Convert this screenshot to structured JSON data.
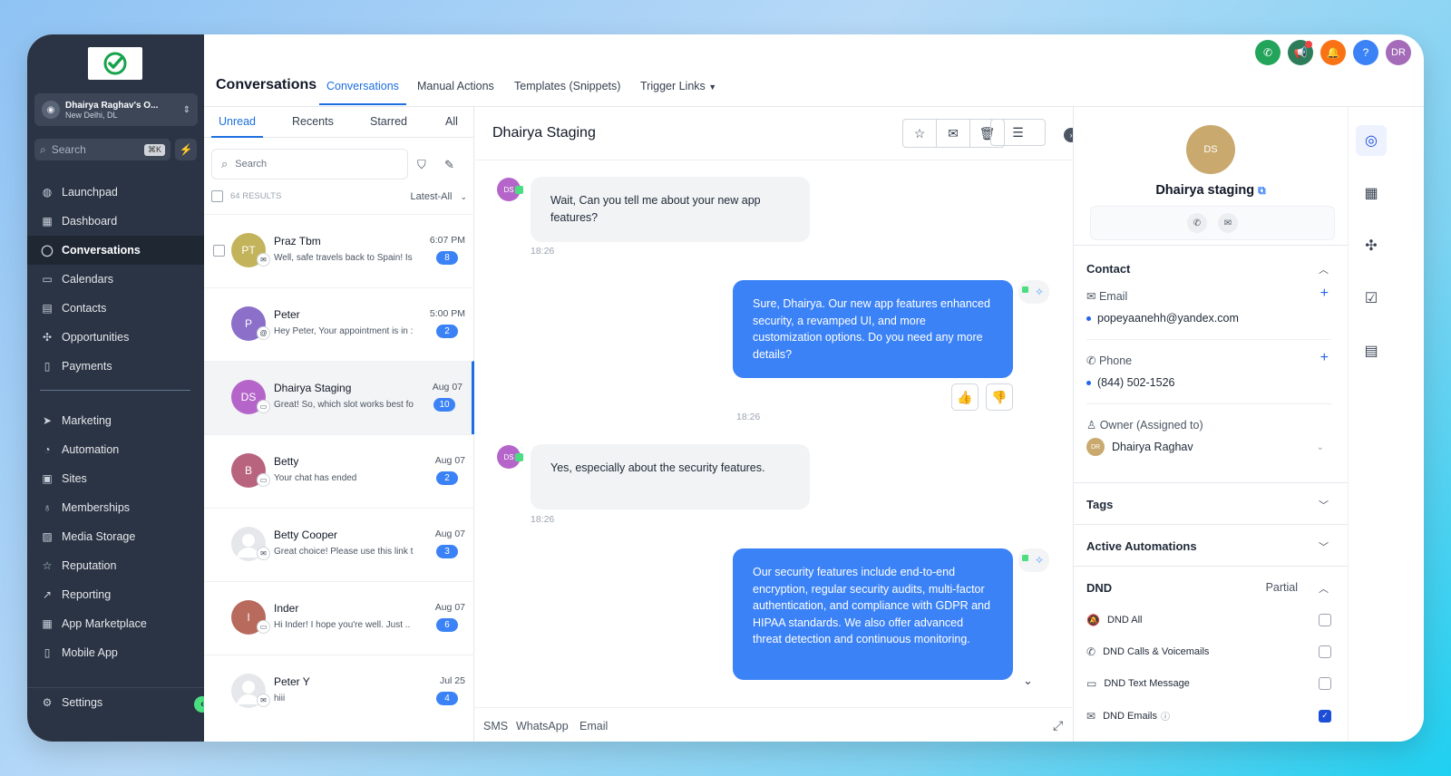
{
  "account": {
    "name": "Dhairya Raghav's O...",
    "location": "New Delhi, DL"
  },
  "sidebar": {
    "search_placeholder": "Search",
    "shortcut": "⌘K",
    "items": [
      "Launchpad",
      "Dashboard",
      "Conversations",
      "Calendars",
      "Contacts",
      "Opportunities",
      "Payments"
    ],
    "items2": [
      "Marketing",
      "Automation",
      "Sites",
      "Memberships",
      "Media Storage",
      "Reputation",
      "Reporting",
      "App Marketplace",
      "Mobile App"
    ],
    "settings": "Settings"
  },
  "header": {
    "title": "Conversations",
    "tabs": [
      "Conversations",
      "Manual Actions",
      "Templates (Snippets)",
      "Trigger Links"
    ],
    "avatar": "DR"
  },
  "list": {
    "tabs": [
      "Unread",
      "Recents",
      "Starred",
      "All"
    ],
    "search_placeholder": "Search",
    "results": "64 RESULTS",
    "sort": "Latest-All",
    "conversations": [
      {
        "initials": "PT",
        "name": "Praz Tbm",
        "preview": "Well, safe travels back to Spain! Is",
        "time": "6:07 PM",
        "count": "8",
        "color": "#c3b35b"
      },
      {
        "initials": "P",
        "name": "Peter",
        "preview": "Hey Peter, Your appointment is in :",
        "time": "5:00 PM",
        "count": "2",
        "color": "#8b6fc9"
      },
      {
        "initials": "DS",
        "name": "Dhairya Staging",
        "preview": "Great! So, which slot works best fo",
        "time": "Aug 07",
        "count": "10",
        "color": "#b565c9"
      },
      {
        "initials": "B",
        "name": "Betty",
        "preview": "Your chat has ended",
        "time": "Aug 07",
        "count": "2",
        "color": "#b9647e"
      },
      {
        "initials": "",
        "name": "Betty Cooper",
        "preview": "Great choice! Please use this link t",
        "time": "Aug 07",
        "count": "3",
        "color": "#e5e7eb"
      },
      {
        "initials": "I",
        "name": "Inder",
        "preview": "Hi Inder! I hope you're well. Just ..",
        "time": "Aug 07",
        "count": "6",
        "color": "#b86a5c"
      },
      {
        "initials": "",
        "name": "Peter Y",
        "preview": "hiii",
        "time": "Jul 25",
        "count": "4",
        "color": "#e5e7eb"
      }
    ]
  },
  "chat": {
    "name": "Dhairya Staging",
    "avatar": "DS",
    "messages": [
      {
        "text": "Wait, Can you tell me about your new app features?",
        "time": "18:26"
      },
      {
        "text": "Sure, Dhairya. Our new app features enhanced security, a revamped UI, and more customization options. Do you need any more details?",
        "time": "18:26"
      },
      {
        "text": "Yes, especially about the security features.",
        "time": "18:26"
      },
      {
        "text": "Our security features include end-to-end encryption, regular security audits, multi-factor authentication, and compliance with GDPR and HIPAA standards. We also offer advanced threat detection and continuous monitoring."
      }
    ],
    "channels": [
      "SMS",
      "WhatsApp",
      "Email"
    ]
  },
  "contact": {
    "avatar": "DS",
    "name": "Dhairya staging",
    "section": "Contact",
    "email_label": "Email",
    "email": "popeyaanehh@yandex.com",
    "phone_label": "Phone",
    "phone": "(844) 502-1526",
    "owner_label": "Owner (Assigned to)",
    "owner": "Dhairya Raghav",
    "owner_avatar": "DR",
    "tags": "Tags",
    "automations": "Active Automations",
    "dnd": "DND",
    "dnd_status": "Partial",
    "dnd_items": [
      "DND All",
      "DND Calls & Voicemails",
      "DND Text Message",
      "DND Emails"
    ]
  }
}
